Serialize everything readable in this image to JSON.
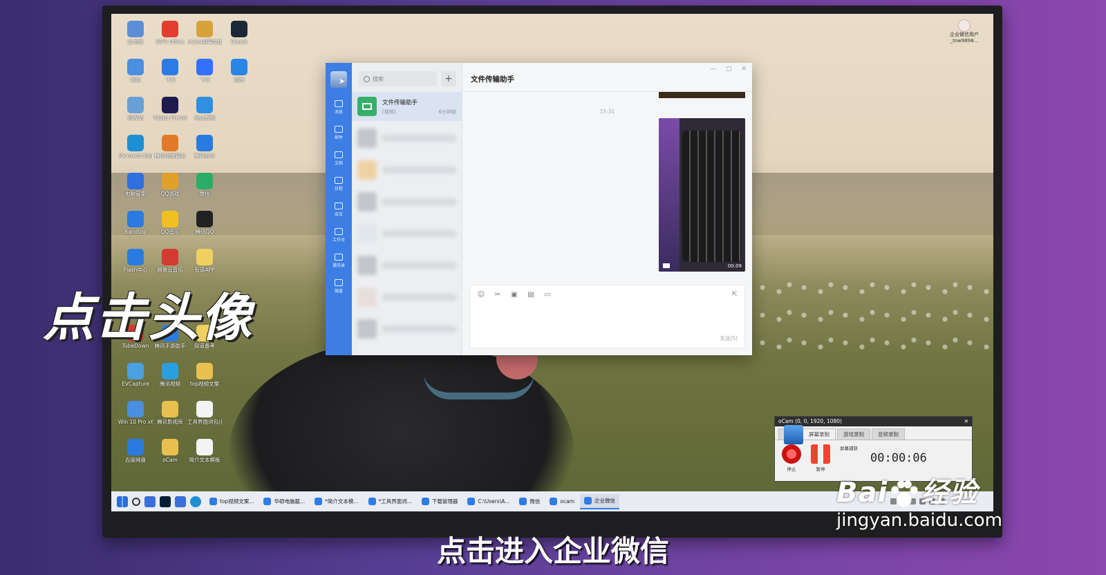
{
  "desktop": {
    "icons": [
      {
        "label": "此电脑",
        "color": "#5b8fd8",
        "col": 0,
        "row": 0
      },
      {
        "label": "WPS Office",
        "color": "#e23d2e",
        "col": 1,
        "row": 0
      },
      {
        "label": "oCam屏幕录像",
        "color": "#d8a23b",
        "col": 2,
        "row": 0
      },
      {
        "label": "Steam",
        "color": "#1b2838",
        "col": 3,
        "row": 0
      },
      {
        "label": "网络",
        "color": "#4a8fe0",
        "col": 0,
        "row": 1
      },
      {
        "label": "飞书",
        "color": "#2c7be5",
        "col": 1,
        "row": 1
      },
      {
        "label": "飞书",
        "color": "#3370ff",
        "col": 2,
        "row": 1
      },
      {
        "label": "剪映",
        "color": "#2a86e6",
        "col": 3,
        "row": 1
      },
      {
        "label": "回收站",
        "color": "#6aa0d8",
        "col": 0,
        "row": 2
      },
      {
        "label": "Adobe Premie...",
        "color": "#1e1a4d",
        "col": 1,
        "row": 2
      },
      {
        "label": "金山数据",
        "color": "#2f8fe0",
        "col": 2,
        "row": 2
      },
      {
        "label": "Microsoft Edge",
        "color": "#1f8fd4",
        "col": 0,
        "row": 3
      },
      {
        "label": "腾讯电脑管家",
        "color": "#e07a2a",
        "col": 1,
        "row": 3
      },
      {
        "label": "腾讯会议",
        "color": "#2a7be0",
        "col": 2,
        "row": 3
      },
      {
        "label": "电脑管家",
        "color": "#2f6fe0",
        "col": 0,
        "row": 4
      },
      {
        "label": "QQ游戏",
        "color": "#e0a02a",
        "col": 1,
        "row": 4
      },
      {
        "label": "微信",
        "color": "#2aae67",
        "col": 2,
        "row": 4
      },
      {
        "label": "Bandizip",
        "color": "#2a7be0",
        "col": 0,
        "row": 5
      },
      {
        "label": "QQ音乐",
        "color": "#f0c020",
        "col": 1,
        "row": 5
      },
      {
        "label": "腾讯QQ",
        "color": "#222222",
        "col": 2,
        "row": 5
      },
      {
        "label": "Flash中心",
        "color": "#2a7be0",
        "col": 0,
        "row": 6
      },
      {
        "label": "网易云音乐",
        "color": "#d33a31",
        "col": 1,
        "row": 6
      },
      {
        "label": "有道APP",
        "color": "#f0d060",
        "col": 2,
        "row": 6
      },
      {
        "label": "TubeDown",
        "color": "#d33a31",
        "col": 0,
        "row": 8
      },
      {
        "label": "腾讯手游助手",
        "color": "#2a7be0",
        "col": 1,
        "row": 8
      },
      {
        "label": "知道备考",
        "color": "#f0d060",
        "col": 2,
        "row": 8
      },
      {
        "label": "EVCapture",
        "color": "#4aa0e0",
        "col": 0,
        "row": 9
      },
      {
        "label": "腾讯视频",
        "color": "#2a9fe0",
        "col": 1,
        "row": 9
      },
      {
        "label": "top视频文案",
        "color": "#e8c050",
        "col": 2,
        "row": 9
      },
      {
        "label": "Win 10 Pro x64 (C)",
        "color": "#4a8fe0",
        "col": 0,
        "row": 10
      },
      {
        "label": "腾讯影视库",
        "color": "#e8c050",
        "col": 1,
        "row": 10
      },
      {
        "label": "工具界面词包(新7.1)",
        "color": "#f3f3f3",
        "col": 2,
        "row": 10
      },
      {
        "label": "百度网盘",
        "color": "#2a7be0",
        "col": 0,
        "row": 11
      },
      {
        "label": "oCam",
        "color": "#e8c050",
        "col": 1,
        "row": 11
      },
      {
        "label": "简介文本模板",
        "color": "#f3f3f3",
        "col": 2,
        "row": 11
      }
    ],
    "user_corner_label": "企业微信用户_tow9898..."
  },
  "wecom": {
    "rail": [
      {
        "label": "消息",
        "name": "rail-messages"
      },
      {
        "label": "邮件",
        "name": "rail-mail"
      },
      {
        "label": "文档",
        "name": "rail-docs"
      },
      {
        "label": "日程",
        "name": "rail-calendar"
      },
      {
        "label": "会议",
        "name": "rail-meeting"
      },
      {
        "label": "工作台",
        "name": "rail-workbench"
      },
      {
        "label": "通讯录",
        "name": "rail-contacts"
      },
      {
        "label": "微盘",
        "name": "rail-drive"
      }
    ],
    "search_placeholder": "搜索",
    "plus": "+",
    "active_conv": {
      "name": "文件传输助手",
      "preview": "[视频]",
      "time": "6分钟前"
    },
    "title": "文件传输助手",
    "timestamp": "15:31",
    "video_duration": "00:09",
    "send_hint": "发送(S)",
    "win_controls": [
      "—",
      "□",
      "✕"
    ],
    "toolbar": [
      "☺",
      "✂",
      "▣",
      "▤",
      "▭"
    ],
    "expand": "⇱"
  },
  "ocam": {
    "title": "oCam (0, 0, 1920, 1080)",
    "close": "✕",
    "tabs": [
      "菜单",
      "屏幕录制",
      "游戏录制",
      "音频录制"
    ],
    "active_tab": 1,
    "buttons": [
      {
        "label": "停止",
        "kind": "stop"
      },
      {
        "label": "暂停",
        "kind": "pause"
      },
      {
        "label": "屏幕捕获",
        "kind": "screen"
      }
    ],
    "timer": "00:00:06"
  },
  "taskbar": {
    "apps": [
      {
        "label": "top视频文案..."
      },
      {
        "label": "华硕电脑截..."
      },
      {
        "label": "*简介文本模..."
      },
      {
        "label": "*工具界面词..."
      },
      {
        "label": "下载管理器"
      },
      {
        "label": "C:\\Users\\A..."
      },
      {
        "label": "微信"
      },
      {
        "label": "ocam"
      },
      {
        "label": "企业微信",
        "active": true
      }
    ]
  },
  "overlay": {
    "big_caption": "点击头像",
    "subtitle": "点击进入企业微信",
    "watermark_logo_left": "Bai",
    "watermark_logo_right": "经验",
    "watermark_url": "jingyan.baidu.com"
  }
}
